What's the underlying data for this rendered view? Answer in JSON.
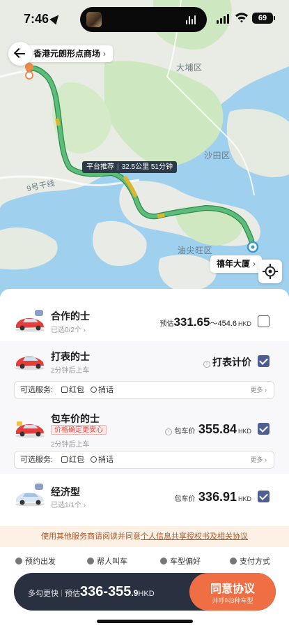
{
  "status_bar": {
    "time": "7:46",
    "battery": "69"
  },
  "map": {
    "pickup": "香港元朗形点商场",
    "destination": "禧年大厦",
    "route_tag": "平台推荐",
    "route_distance": "32.5公里",
    "route_time": "51分钟",
    "places": [
      "大埔区",
      "沙田区",
      "9号干线",
      "油尖旺区"
    ]
  },
  "services": [
    {
      "name": "合作的士",
      "sub": "已选0/2个",
      "price_prefix": "预估",
      "price_main": "331.65",
      "price_tail": "～454.6",
      "unit": "HKD",
      "checked": false
    },
    {
      "name": "打表的士",
      "sub": "2分钟后上车",
      "meter_label": "打表计价",
      "checked": true
    },
    {
      "name": "包车价的士",
      "tag": "价格确定更安心",
      "sub": "2分钟后上车",
      "price_prefix": "包车价",
      "price_main": "355.84",
      "unit": "HKD",
      "checked": true
    },
    {
      "name": "经济型",
      "sub": "已选1/1个",
      "price_prefix": "包车价",
      "price_main": "336.91",
      "unit": "HKD",
      "checked": true
    }
  ],
  "options": {
    "label": "可选服务:",
    "items": [
      "红包",
      "捎话"
    ],
    "more": "更多"
  },
  "agreement": {
    "text": "使用其他服务商请阅读并同意",
    "link": "个人信息共享授权书及相关协议"
  },
  "tools": [
    "预约出发",
    "帮人叫车",
    "车型偏好",
    "支付方式"
  ],
  "cta": {
    "left_a": "多勾更快",
    "left_b": "预估",
    "price_main": "336-355",
    "price_tail": ".9",
    "unit": "HKD",
    "button": "同意协议",
    "button_sub": "并呼叫3种车型"
  },
  "colors": {
    "route": "#5cbd7a",
    "checkbox": "#4e5d92",
    "cta_button": "#ef6e44",
    "cta_bar": "#29303f",
    "agreement_bg": "#fdf0e4"
  }
}
